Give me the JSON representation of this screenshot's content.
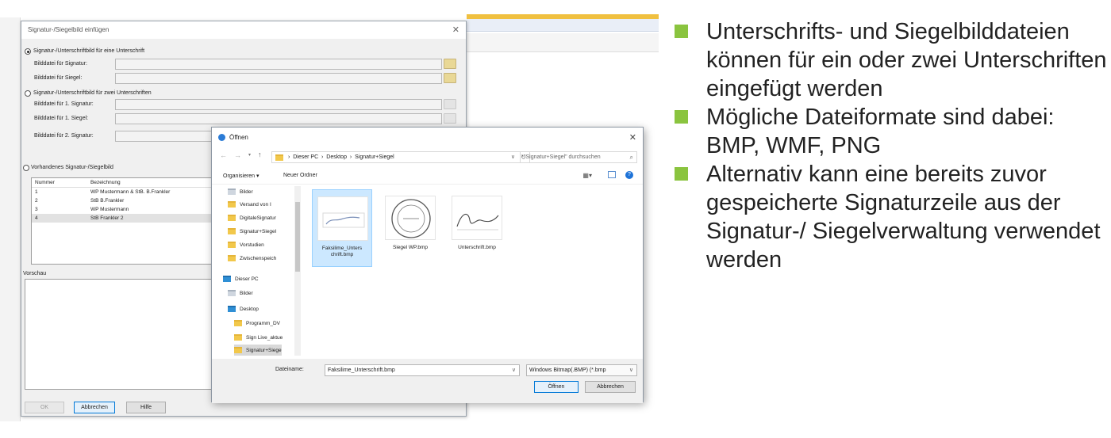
{
  "main_dialog": {
    "title": "Signatur-/Siegelbild einfügen",
    "option_one": "Signatur-/Unterschriftbild für eine Unterschrift",
    "label_sig": "Bilddatei für Signatur:",
    "label_seal": "Bilddatei für Siegel:",
    "option_two": "Signatur-/Unterschriftbild für zwei Unterschriften",
    "label_sig1": "Bilddatei für 1. Signatur:",
    "label_seal1": "Bilddatei für 1. Siegel:",
    "label_sig2": "Bilddatei für 2. Signatur:",
    "option_existing": "Vorhandenes Signatur-/Siegelbild",
    "list_headers": [
      "Nummer",
      "Bezeichnung"
    ],
    "list_rows": [
      {
        "num": "1",
        "name": "WP Mustermann & StB. B.Frankler"
      },
      {
        "num": "2",
        "name": "StB B.Frankler"
      },
      {
        "num": "3",
        "name": "WP Mustermann"
      },
      {
        "num": "4",
        "name": "StB Frankler 2"
      }
    ],
    "preview_label": "Vorschau",
    "btn_ok": "OK",
    "btn_cancel": "Abbrechen",
    "btn_help": "Hilfe"
  },
  "open_dialog": {
    "title": "Öffnen",
    "path": [
      "Dieser PC",
      "Desktop",
      "Signatur+Siegel"
    ],
    "search_placeholder": "\"Signatur+Siegel\" durchsuchen",
    "organize": "Organisieren ▾",
    "new_folder": "Neuer Ordner",
    "nav_items": [
      "Bilder",
      "Versand von I",
      "DigitaleSignatur",
      "Signatur+Siegel",
      "Vorstudien",
      "Zwischenspeich",
      "Dieser PC",
      "Bilder",
      "Desktop",
      "Programm_DV",
      "Sign Live_aktue",
      "Signatur+Siege"
    ],
    "files": [
      {
        "name": "Faksilime_Unterschrift.bmp",
        "line1": "Faksilime_Unters",
        "line2": "chrift.bmp"
      },
      {
        "name": "Siegel WP.bmp",
        "line1": "Siegel WP.bmp",
        "line2": ""
      },
      {
        "name": "Unterschrift.bmp",
        "line1": "Unterschrift.bmp",
        "line2": ""
      }
    ],
    "filename_label": "Dateiname:",
    "filename_value": "Faksilime_Unterschrift.bmp",
    "filetype_value": "Windows Bitmap(.BMP) (*.bmp",
    "btn_open": "Öffnen",
    "btn_cancel": "Abbrechen"
  },
  "bullets": [
    "Unterschrifts- und Siegelbilddateien können für ein oder zwei Unterschriften eingefügt werden",
    "Mögliche Dateiformate sind dabei: BMP, WMF, PNG",
    "Alternativ kann eine bereits zuvor gespeicherte Signaturzeile aus der Signatur-/ Siegelverwaltung verwendet werden"
  ],
  "colors": {
    "bullet_accent": "#8ac43f",
    "selection": "#cce8ff",
    "window_border": "#8d97a3"
  }
}
